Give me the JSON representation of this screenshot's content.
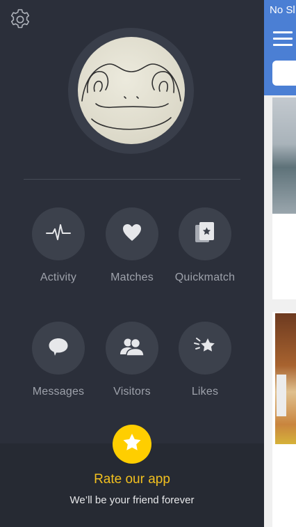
{
  "drawer": {
    "settings_icon": "gear-icon",
    "avatar_alt": "profile-doodle",
    "menu": [
      {
        "label": "Activity",
        "icon": "pulse-icon"
      },
      {
        "label": "Matches",
        "icon": "heart-icon"
      },
      {
        "label": "Quickmatch",
        "icon": "cards-star-icon"
      },
      {
        "label": "Messages",
        "icon": "speech-bubble-icon"
      },
      {
        "label": "Visitors",
        "icon": "people-icon"
      },
      {
        "label": "Likes",
        "icon": "sparkle-star-icon"
      }
    ],
    "rate": {
      "title": "Rate our app",
      "subtitle": "We’ll be your friend forever",
      "icon": "star-icon"
    }
  },
  "peek": {
    "status_text": "No Sl",
    "menu_icon": "hamburger-icon"
  },
  "colors": {
    "drawer_bg": "#2b2f3a",
    "circle_bg": "#3c414c",
    "accent": "#ffce00",
    "header_blue": "#4b7fd4"
  }
}
